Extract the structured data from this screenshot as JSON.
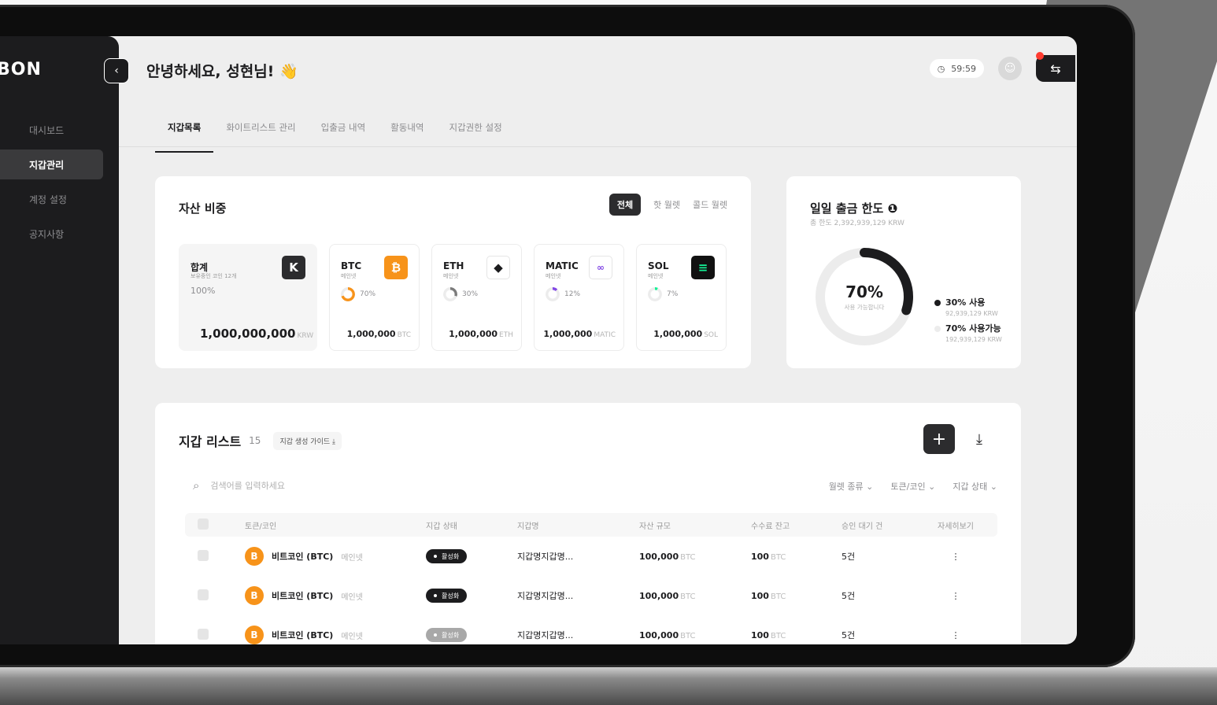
{
  "brand": {
    "logo": "ARBON"
  },
  "sidebar": {
    "items": [
      {
        "label": "대시보드"
      },
      {
        "label": "지갑관리"
      },
      {
        "label": "계정 설정"
      },
      {
        "label": "공지사항"
      }
    ]
  },
  "header": {
    "greeting": "안녕하세요, 성현님! 👋",
    "timer": "59:59"
  },
  "tabs": [
    {
      "label": "지갑목록"
    },
    {
      "label": "화이트리스트 관리"
    },
    {
      "label": "입출금 내역"
    },
    {
      "label": "활동내역"
    },
    {
      "label": "지갑권한 설정"
    }
  ],
  "asset_share": {
    "title": "자산 비중",
    "segments": [
      "전체",
      "핫 월렛",
      "콜드 월렛"
    ],
    "total": {
      "name": "합계",
      "sub": "보유중인 코인 12개",
      "pct": "100%",
      "amount": "1,000,000,000",
      "unit": "KRW",
      "icon": "K"
    },
    "coins": [
      {
        "name": "BTC",
        "sub": "메인넷",
        "pct": "70%",
        "pct_value": 70,
        "amount": "1,000,000",
        "unit": "BTC",
        "color": "#f7931a"
      },
      {
        "name": "ETH",
        "sub": "메인넷",
        "pct": "30%",
        "pct_value": 30,
        "amount": "1,000,000",
        "unit": "ETH",
        "color": "#7a7a7a"
      },
      {
        "name": "MATIC",
        "sub": "메인넷",
        "pct": "12%",
        "pct_value": 12,
        "amount": "1,000,000",
        "unit": "MATIC",
        "color": "#8247e5"
      },
      {
        "name": "SOL",
        "sub": "메인넷",
        "pct": "7%",
        "pct_value": 7,
        "amount": "1,000,000",
        "unit": "SOL",
        "color": "#14f195"
      }
    ]
  },
  "daily_limit": {
    "title": "일일 출금 한도",
    "sub": "총 한도 2,392,939,129 KRW",
    "center_pct": "70%",
    "center_label": "사용 가능합니다",
    "used_fraction": 0.3,
    "legend": [
      {
        "label": "30% 사용",
        "amount": "92,939,129 KRW",
        "color": "#1c1c1e"
      },
      {
        "label": "70% 사용가능",
        "amount": "192,939,129 KRW",
        "color": "#ececec"
      }
    ]
  },
  "wallet_list": {
    "title": "지갑 리스트",
    "count": "15",
    "guide": "지갑 생성 가이드 ⤓",
    "search_placeholder": "검색어를 입력하세요",
    "filters": [
      "월렛 종류 ⌄",
      "토큰/코인 ⌄",
      "지갑 상태 ⌄"
    ],
    "columns": [
      "토큰/코인",
      "지갑 상태",
      "지갑명",
      "자산 규모",
      "수수료 잔고",
      "승인 대기 건",
      "자세히보기"
    ],
    "rows": [
      {
        "coin": "비트코인 (BTC)",
        "net": "메인넷",
        "status": "활성화",
        "active": true,
        "wallet": "지갑명지갑명...",
        "asset": "100,000",
        "asset_unit": "BTC",
        "fee": "100",
        "fee_unit": "BTC",
        "pending": "5건"
      },
      {
        "coin": "비트코인 (BTC)",
        "net": "메인넷",
        "status": "활성화",
        "active": true,
        "wallet": "지갑명지갑명...",
        "asset": "100,000",
        "asset_unit": "BTC",
        "fee": "100",
        "fee_unit": "BTC",
        "pending": "5건"
      },
      {
        "coin": "비트코인 (BTC)",
        "net": "메인넷",
        "status": "활성화",
        "active": false,
        "wallet": "지갑명지갑명...",
        "asset": "100,000",
        "asset_unit": "BTC",
        "fee": "100",
        "fee_unit": "BTC",
        "pending": "5건"
      }
    ]
  }
}
